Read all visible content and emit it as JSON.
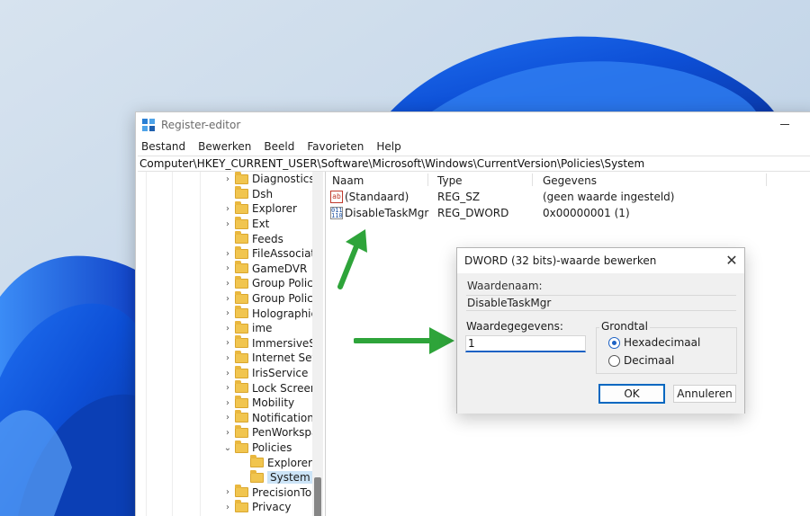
{
  "window": {
    "title": "Register-editor",
    "menu": [
      "Bestand",
      "Bewerken",
      "Beeld",
      "Favorieten",
      "Help"
    ],
    "address": "Computer\\HKEY_CURRENT_USER\\Software\\Microsoft\\Windows\\CurrentVersion\\Policies\\System"
  },
  "tree": [
    {
      "label": "Diagnostics",
      "expander": "›"
    },
    {
      "label": "Dsh",
      "expander": ""
    },
    {
      "label": "Explorer",
      "expander": "›"
    },
    {
      "label": "Ext",
      "expander": "›"
    },
    {
      "label": "Feeds",
      "expander": ""
    },
    {
      "label": "FileAssociati",
      "expander": "›"
    },
    {
      "label": "GameDVR",
      "expander": "›"
    },
    {
      "label": "Group Policy",
      "expander": "›"
    },
    {
      "label": "Group Policy",
      "expander": "›"
    },
    {
      "label": "Holographic",
      "expander": "›"
    },
    {
      "label": "ime",
      "expander": "›"
    },
    {
      "label": "ImmersiveSh",
      "expander": "›"
    },
    {
      "label": "Internet Sett",
      "expander": "›"
    },
    {
      "label": "IrisService",
      "expander": "›"
    },
    {
      "label": "Lock Screen",
      "expander": "›"
    },
    {
      "label": "Mobility",
      "expander": "›"
    },
    {
      "label": "Notifications",
      "expander": "›"
    },
    {
      "label": "PenWorkspa",
      "expander": "›"
    },
    {
      "label": "Policies",
      "expander": "⌄"
    },
    {
      "label": "Explorer",
      "expander": ""
    },
    {
      "label": "System",
      "expander": ""
    },
    {
      "label": "PrecisionTou",
      "expander": "›"
    },
    {
      "label": "Privacy",
      "expander": "›"
    }
  ],
  "list": {
    "columns": [
      "Naam",
      "Type",
      "Gegevens"
    ],
    "rows": [
      {
        "icon": "ab",
        "name": "(Standaard)",
        "type": "REG_SZ",
        "data": "(geen waarde ingesteld)"
      },
      {
        "icon": "011\n110",
        "name": "DisableTaskMgr",
        "type": "REG_DWORD",
        "data": "0x00000001 (1)"
      }
    ]
  },
  "dialog": {
    "title": "DWORD (32 bits)-waarde bewerken",
    "close_glyph": "✕",
    "value_name_label": "Waardenaam:",
    "value_name": "DisableTaskMgr",
    "value_data_label": "Waardegegevens:",
    "value_data": "1",
    "base_label": "Grondtal",
    "base_hex": "Hexadecimaal",
    "base_dec": "Decimaal",
    "selected_base": "Hexadecimaal",
    "ok": "OK",
    "cancel": "Annuleren"
  },
  "colors": {
    "arrow": "#2ea43a",
    "accent": "#1d62c4",
    "folder": "#f1c54f"
  }
}
